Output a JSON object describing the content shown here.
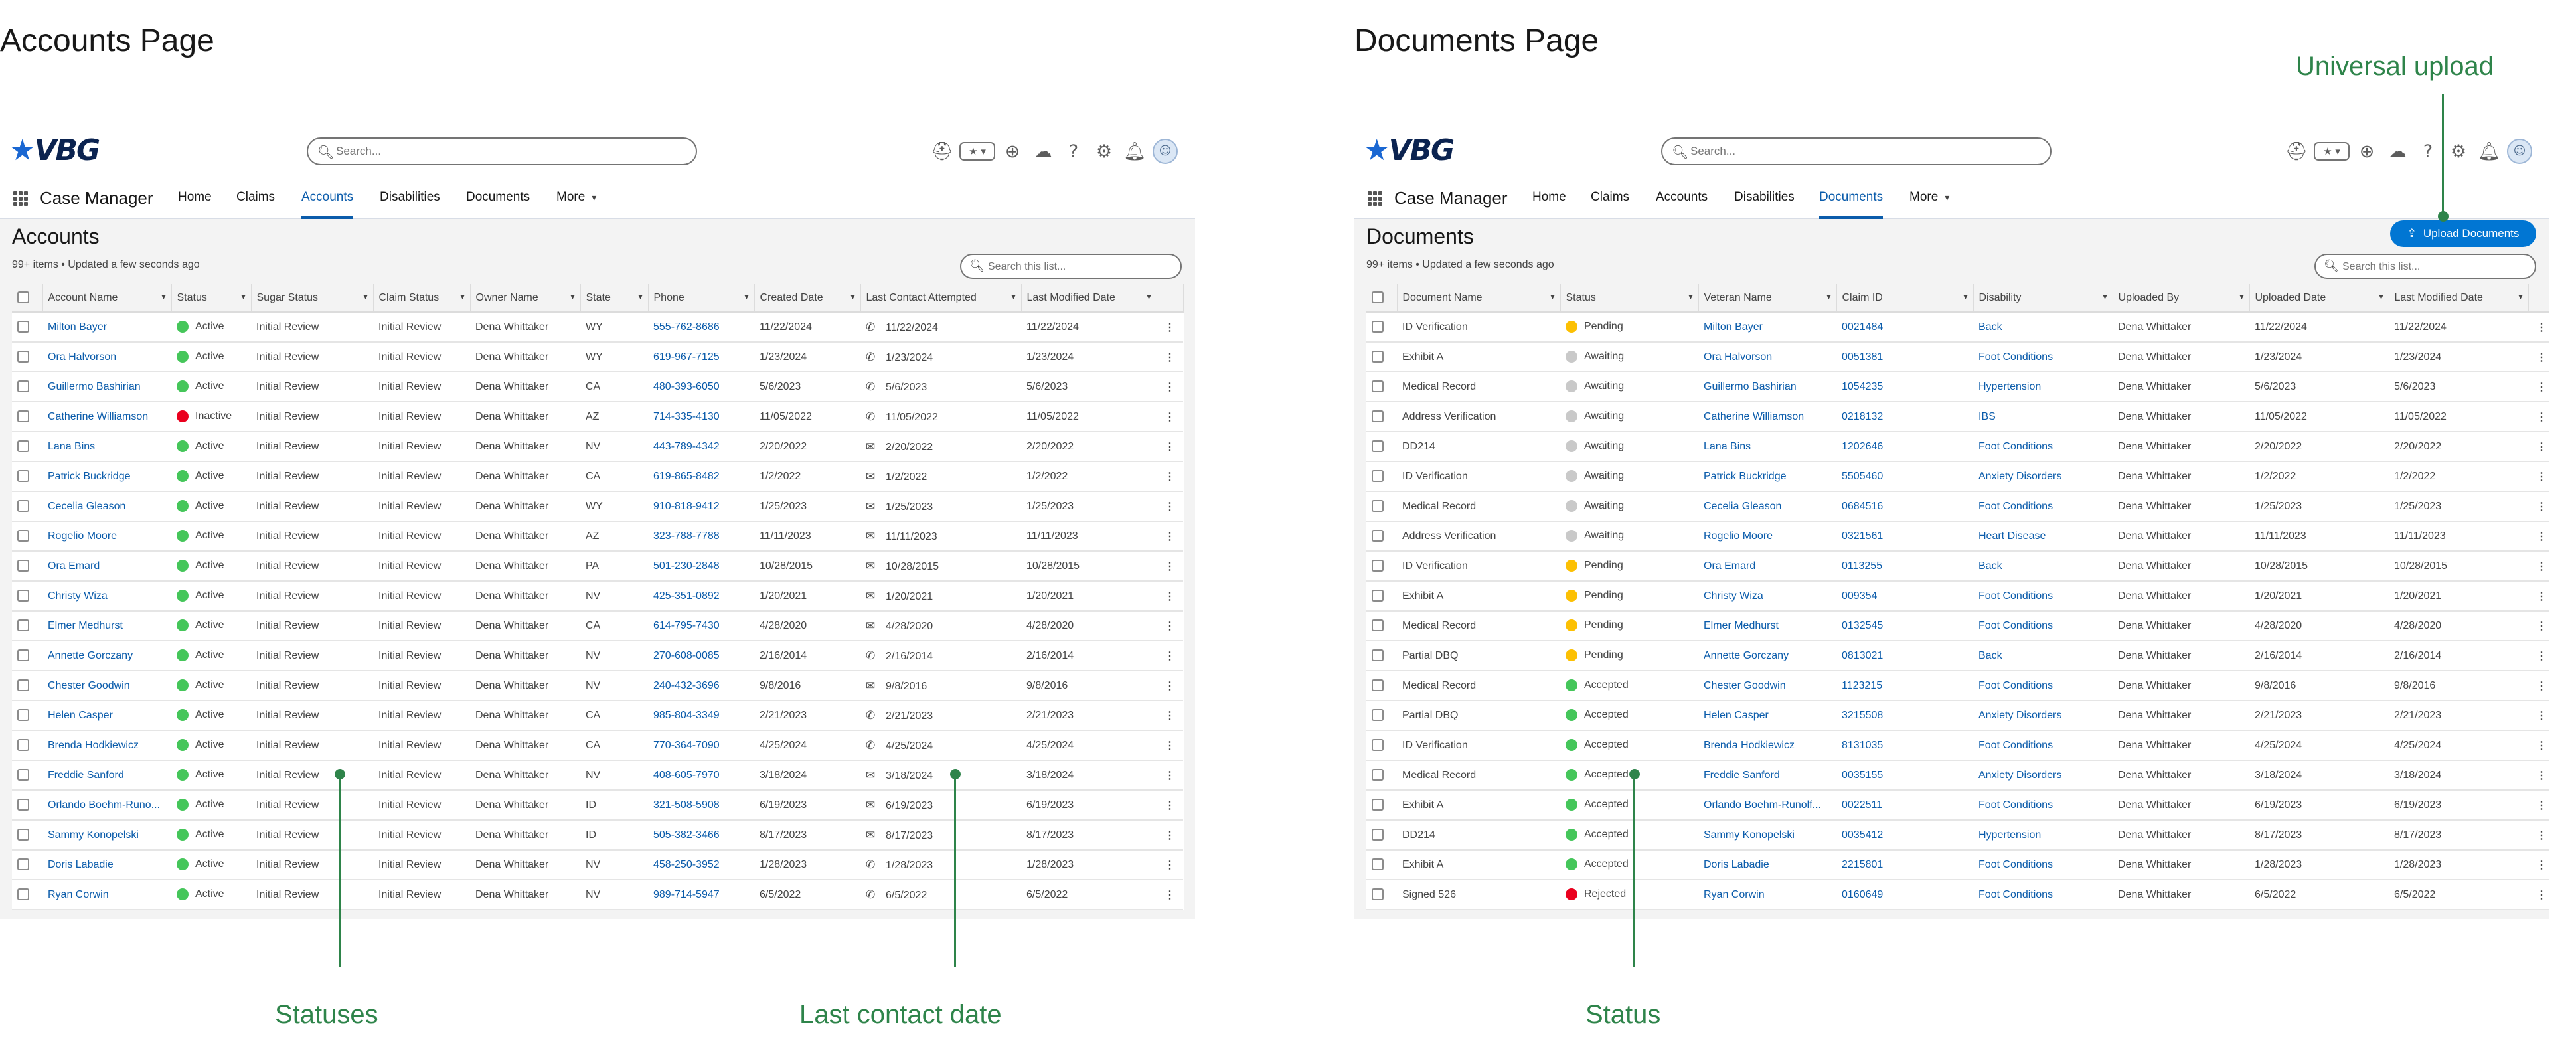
{
  "accounts_page": {
    "heading": "Accounts Page",
    "search_placeholder": "Search...",
    "app_name": "Case Manager",
    "tabs": [
      "Home",
      "Claims",
      "Accounts",
      "Disabilities",
      "Documents",
      "More"
    ],
    "active_tab": "Accounts",
    "list_title": "Accounts",
    "meta": "99+ items • Updated a few seconds ago",
    "list_search_placeholder": "Search this list...",
    "columns": [
      "Account Name",
      "Status",
      "Sugar Status",
      "Claim Status",
      "Owner Name",
      "State",
      "Phone",
      "Created Date",
      "Last Contact Attempted",
      "Last Modified Date"
    ],
    "rows": [
      {
        "name": "Milton Bayer",
        "status": "Active",
        "sugar": "Initial Review",
        "claim": "Initial Review",
        "owner": "Dena Whittaker",
        "state": "WY",
        "phone": "555-762-8686",
        "created": "11/22/2024",
        "contact_type": "phone",
        "contact": "11/22/2024",
        "modified": "11/22/2024"
      },
      {
        "name": "Ora Halvorson",
        "status": "Active",
        "sugar": "Initial Review",
        "claim": "Initial Review",
        "owner": "Dena Whittaker",
        "state": "WY",
        "phone": "619-967-7125",
        "created": "1/23/2024",
        "contact_type": "phone",
        "contact": "1/23/2024",
        "modified": "1/23/2024"
      },
      {
        "name": "Guillermo Bashirian",
        "status": "Active",
        "sugar": "Initial Review",
        "claim": "Initial Review",
        "owner": "Dena Whittaker",
        "state": "CA",
        "phone": "480-393-6050",
        "created": "5/6/2023",
        "contact_type": "phone",
        "contact": "5/6/2023",
        "modified": "5/6/2023"
      },
      {
        "name": "Catherine Williamson",
        "status": "Inactive",
        "sugar": "Initial Review",
        "claim": "Initial Review",
        "owner": "Dena Whittaker",
        "state": "AZ",
        "phone": "714-335-4130",
        "created": "11/05/2022",
        "contact_type": "phone",
        "contact": "11/05/2022",
        "modified": "11/05/2022"
      },
      {
        "name": "Lana Bins",
        "status": "Active",
        "sugar": "Initial Review",
        "claim": "Initial Review",
        "owner": "Dena Whittaker",
        "state": "NV",
        "phone": "443-789-4342",
        "created": "2/20/2022",
        "contact_type": "email",
        "contact": "2/20/2022",
        "modified": "2/20/2022"
      },
      {
        "name": "Patrick Buckridge",
        "status": "Active",
        "sugar": "Initial Review",
        "claim": "Initial Review",
        "owner": "Dena Whittaker",
        "state": "CA",
        "phone": "619-865-8482",
        "created": "1/2/2022",
        "contact_type": "email",
        "contact": "1/2/2022",
        "modified": "1/2/2022"
      },
      {
        "name": "Cecelia Gleason",
        "status": "Active",
        "sugar": "Initial Review",
        "claim": "Initial Review",
        "owner": "Dena Whittaker",
        "state": "WY",
        "phone": "910-818-9412",
        "created": "1/25/2023",
        "contact_type": "email",
        "contact": "1/25/2023",
        "modified": "1/25/2023"
      },
      {
        "name": "Rogelio Moore",
        "status": "Active",
        "sugar": "Initial Review",
        "claim": "Initial Review",
        "owner": "Dena Whittaker",
        "state": "AZ",
        "phone": "323-788-7788",
        "created": "11/11/2023",
        "contact_type": "email",
        "contact": "11/11/2023",
        "modified": "11/11/2023"
      },
      {
        "name": "Ora Emard",
        "status": "Active",
        "sugar": "Initial Review",
        "claim": "Initial Review",
        "owner": "Dena Whittaker",
        "state": "PA",
        "phone": "501-230-2848",
        "created": "10/28/2015",
        "contact_type": "email",
        "contact": "10/28/2015",
        "modified": "10/28/2015"
      },
      {
        "name": "Christy Wiza",
        "status": "Active",
        "sugar": "Initial Review",
        "claim": "Initial Review",
        "owner": "Dena Whittaker",
        "state": "NV",
        "phone": "425-351-0892",
        "created": "1/20/2021",
        "contact_type": "email",
        "contact": "1/20/2021",
        "modified": "1/20/2021"
      },
      {
        "name": "Elmer Medhurst",
        "status": "Active",
        "sugar": "Initial Review",
        "claim": "Initial Review",
        "owner": "Dena Whittaker",
        "state": "CA",
        "phone": "614-795-7430",
        "created": "4/28/2020",
        "contact_type": "email",
        "contact": "4/28/2020",
        "modified": "4/28/2020"
      },
      {
        "name": "Annette Gorczany",
        "status": "Active",
        "sugar": "Initial Review",
        "claim": "Initial Review",
        "owner": "Dena Whittaker",
        "state": "NV",
        "phone": "270-608-0085",
        "created": "2/16/2014",
        "contact_type": "phone",
        "contact": "2/16/2014",
        "modified": "2/16/2014"
      },
      {
        "name": "Chester Goodwin",
        "status": "Active",
        "sugar": "Initial Review",
        "claim": "Initial Review",
        "owner": "Dena Whittaker",
        "state": "NV",
        "phone": "240-432-3696",
        "created": "9/8/2016",
        "contact_type": "email",
        "contact": "9/8/2016",
        "modified": "9/8/2016"
      },
      {
        "name": "Helen Casper",
        "status": "Active",
        "sugar": "Initial Review",
        "claim": "Initial Review",
        "owner": "Dena Whittaker",
        "state": "CA",
        "phone": "985-804-3349",
        "created": "2/21/2023",
        "contact_type": "phone",
        "contact": "2/21/2023",
        "modified": "2/21/2023"
      },
      {
        "name": "Brenda Hodkiewicz",
        "status": "Active",
        "sugar": "Initial Review",
        "claim": "Initial Review",
        "owner": "Dena Whittaker",
        "state": "CA",
        "phone": "770-364-7090",
        "created": "4/25/2024",
        "contact_type": "phone",
        "contact": "4/25/2024",
        "modified": "4/25/2024"
      },
      {
        "name": "Freddie Sanford",
        "status": "Active",
        "sugar": "Initial Review",
        "claim": "Initial Review",
        "owner": "Dena Whittaker",
        "state": "NV",
        "phone": "408-605-7970",
        "created": "3/18/2024",
        "contact_type": "email",
        "contact": "3/18/2024",
        "modified": "3/18/2024"
      },
      {
        "name": "Orlando Boehm-Runo...",
        "status": "Active",
        "sugar": "Initial Review",
        "claim": "Initial Review",
        "owner": "Dena Whittaker",
        "state": "ID",
        "phone": "321-508-5908",
        "created": "6/19/2023",
        "contact_type": "email",
        "contact": "6/19/2023",
        "modified": "6/19/2023"
      },
      {
        "name": "Sammy Konopelski",
        "status": "Active",
        "sugar": "Initial Review",
        "claim": "Initial Review",
        "owner": "Dena Whittaker",
        "state": "ID",
        "phone": "505-382-3466",
        "created": "8/17/2023",
        "contact_type": "email",
        "contact": "8/17/2023",
        "modified": "8/17/2023"
      },
      {
        "name": "Doris Labadie",
        "status": "Active",
        "sugar": "Initial Review",
        "claim": "Initial Review",
        "owner": "Dena Whittaker",
        "state": "NV",
        "phone": "458-250-3952",
        "created": "1/28/2023",
        "contact_type": "phone",
        "contact": "1/28/2023",
        "modified": "1/28/2023"
      },
      {
        "name": "Ryan Corwin",
        "status": "Active",
        "sugar": "Initial Review",
        "claim": "Initial Review",
        "owner": "Dena Whittaker",
        "state": "NV",
        "phone": "989-714-5947",
        "created": "6/5/2022",
        "contact_type": "phone",
        "contact": "6/5/2022",
        "modified": "6/5/2022"
      }
    ],
    "callouts": {
      "statuses": "Statuses",
      "last_contact": "Last contact date"
    }
  },
  "documents_page": {
    "heading": "Documents Page",
    "search_placeholder": "Search...",
    "app_name": "Case Manager",
    "tabs": [
      "Home",
      "Claims",
      "Accounts",
      "Disabilities",
      "Documents",
      "More"
    ],
    "active_tab": "Documents",
    "list_title": "Documents",
    "meta": "99+ items • Updated a few seconds ago",
    "list_search_placeholder": "Search this list...",
    "upload_label": "Upload Documents",
    "columns": [
      "Document Name",
      "Status",
      "Veteran Name",
      "Claim ID",
      "Disability",
      "Uploaded By",
      "Uploaded Date",
      "Last Modified Date"
    ],
    "rows": [
      {
        "doc": "ID Verification",
        "status": "Pending",
        "veteran": "Milton Bayer",
        "claim_id": "0021484",
        "disability": "Back",
        "by": "Dena Whittaker",
        "uploaded": "11/22/2024",
        "modified": "11/22/2024"
      },
      {
        "doc": "Exhibit A",
        "status": "Awaiting",
        "veteran": "Ora Halvorson",
        "claim_id": "0051381",
        "disability": "Foot Conditions",
        "by": "Dena Whittaker",
        "uploaded": "1/23/2024",
        "modified": "1/23/2024"
      },
      {
        "doc": "Medical Record",
        "status": "Awaiting",
        "veteran": "Guillermo Bashirian",
        "claim_id": "1054235",
        "disability": "Hypertension",
        "by": "Dena Whittaker",
        "uploaded": "5/6/2023",
        "modified": "5/6/2023"
      },
      {
        "doc": "Address Verification",
        "status": "Awaiting",
        "veteran": "Catherine Williamson",
        "claim_id": "0218132",
        "disability": "IBS",
        "by": "Dena Whittaker",
        "uploaded": "11/05/2022",
        "modified": "11/05/2022"
      },
      {
        "doc": "DD214",
        "status": "Awaiting",
        "veteran": "Lana Bins",
        "claim_id": "1202646",
        "disability": "Foot Conditions",
        "by": "Dena Whittaker",
        "uploaded": "2/20/2022",
        "modified": "2/20/2022"
      },
      {
        "doc": "ID Verification",
        "status": "Awaiting",
        "veteran": "Patrick Buckridge",
        "claim_id": "5505460",
        "disability": "Anxiety Disorders",
        "by": "Dena Whittaker",
        "uploaded": "1/2/2022",
        "modified": "1/2/2022"
      },
      {
        "doc": "Medical Record",
        "status": "Awaiting",
        "veteran": "Cecelia Gleason",
        "claim_id": "0684516",
        "disability": "Foot Conditions",
        "by": "Dena Whittaker",
        "uploaded": "1/25/2023",
        "modified": "1/25/2023"
      },
      {
        "doc": "Address Verification",
        "status": "Awaiting",
        "veteran": "Rogelio Moore",
        "claim_id": "0321561",
        "disability": "Heart Disease",
        "by": "Dena Whittaker",
        "uploaded": "11/11/2023",
        "modified": "11/11/2023"
      },
      {
        "doc": "ID Verification",
        "status": "Pending",
        "veteran": "Ora Emard",
        "claim_id": "0113255",
        "disability": "Back",
        "by": "Dena Whittaker",
        "uploaded": "10/28/2015",
        "modified": "10/28/2015"
      },
      {
        "doc": "Exhibit A",
        "status": "Pending",
        "veteran": "Christy Wiza",
        "claim_id": "009354",
        "disability": "Foot Conditions",
        "by": "Dena Whittaker",
        "uploaded": "1/20/2021",
        "modified": "1/20/2021"
      },
      {
        "doc": "Medical Record",
        "status": "Pending",
        "veteran": "Elmer Medhurst",
        "claim_id": "0132545",
        "disability": "Foot Conditions",
        "by": "Dena Whittaker",
        "uploaded": "4/28/2020",
        "modified": "4/28/2020"
      },
      {
        "doc": "Partial DBQ",
        "status": "Pending",
        "veteran": "Annette Gorczany",
        "claim_id": "0813021",
        "disability": "Back",
        "by": "Dena Whittaker",
        "uploaded": "2/16/2014",
        "modified": "2/16/2014"
      },
      {
        "doc": "Medical Record",
        "status": "Accepted",
        "veteran": "Chester Goodwin",
        "claim_id": "1123215",
        "disability": "Foot Conditions",
        "by": "Dena Whittaker",
        "uploaded": "9/8/2016",
        "modified": "9/8/2016"
      },
      {
        "doc": "Partial DBQ",
        "status": "Accepted",
        "veteran": "Helen Casper",
        "claim_id": "3215508",
        "disability": "Anxiety Disorders",
        "by": "Dena Whittaker",
        "uploaded": "2/21/2023",
        "modified": "2/21/2023"
      },
      {
        "doc": "ID Verification",
        "status": "Accepted",
        "veteran": "Brenda Hodkiewicz",
        "claim_id": "8131035",
        "disability": "Foot Conditions",
        "by": "Dena Whittaker",
        "uploaded": "4/25/2024",
        "modified": "4/25/2024"
      },
      {
        "doc": "Medical Record",
        "status": "Accepted",
        "veteran": "Freddie Sanford",
        "claim_id": "0035155",
        "disability": "Anxiety Disorders",
        "by": "Dena Whittaker",
        "uploaded": "3/18/2024",
        "modified": "3/18/2024"
      },
      {
        "doc": "Exhibit A",
        "status": "Accepted",
        "veteran": "Orlando Boehm-Runolf...",
        "claim_id": "0022511",
        "disability": "Foot Conditions",
        "by": "Dena Whittaker",
        "uploaded": "6/19/2023",
        "modified": "6/19/2023"
      },
      {
        "doc": "DD214",
        "status": "Accepted",
        "veteran": "Sammy Konopelski",
        "claim_id": "0035412",
        "disability": "Hypertension",
        "by": "Dena Whittaker",
        "uploaded": "8/17/2023",
        "modified": "8/17/2023"
      },
      {
        "doc": "Exhibit A",
        "status": "Accepted",
        "veteran": "Doris Labadie",
        "claim_id": "2215801",
        "disability": "Foot Conditions",
        "by": "Dena Whittaker",
        "uploaded": "1/28/2023",
        "modified": "1/28/2023"
      },
      {
        "doc": "Signed 526",
        "status": "Rejected",
        "veteran": "Ryan Corwin",
        "claim_id": "0160649",
        "disability": "Foot Conditions",
        "by": "Dena Whittaker",
        "uploaded": "6/5/2022",
        "modified": "6/5/2022"
      }
    ],
    "callouts": {
      "universal_upload": "Universal upload",
      "status": "Status"
    }
  },
  "brand": {
    "logo_star": "★",
    "logo_text": "VBG"
  },
  "icons": {
    "search": "search-icon",
    "phone": "phone-icon",
    "email": "envelope-icon",
    "menu": "row-menu-icon"
  },
  "status_colors": {
    "Active": "#45c65a",
    "Inactive": "#ea001e",
    "Pending": "#fcc003",
    "Awaiting": "#c9c9c9",
    "Accepted": "#45c65a",
    "Rejected": "#ea001e"
  },
  "colors": {
    "brand_blue": "#0176d3",
    "link": "#0b5cab",
    "callout": "#2e844a"
  }
}
